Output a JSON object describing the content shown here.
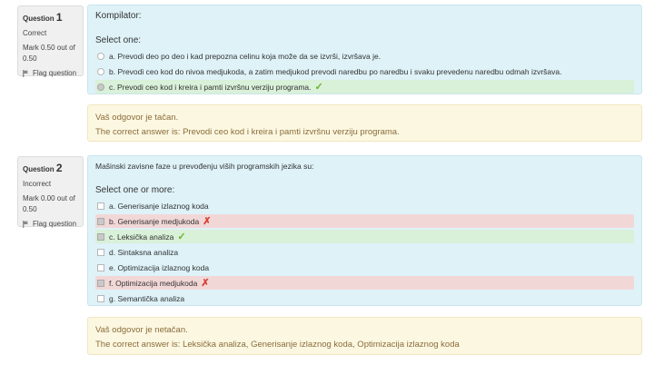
{
  "q1": {
    "label": "Question",
    "number": "1",
    "state": "Correct",
    "grade": "Mark 0.50 out of 0.50",
    "flag": "Flag question",
    "qtext": "Kompilator:",
    "prompt": "Select one:",
    "options": [
      {
        "text": "a. Prevodi deo po deo i kad prepozna celinu koja može da se izvrši, izvršava je."
      },
      {
        "text": "b. Prevodi ceo kod do nivoa medjukoda, a zatim medjukod prevodi naredbu po naredbu i svaku prevedenu naredbu odmah izvršava."
      },
      {
        "text": "c. Prevodi ceo kod i kreira i pamti izvršnu verziju programa."
      }
    ],
    "feedback": "Vaš odgovor je tačan.",
    "right_answer": "The correct answer is: Prevodi ceo kod i kreira i pamti izvršnu verziju programa."
  },
  "q2": {
    "label": "Question",
    "number": "2",
    "state": "Incorrect",
    "grade": "Mark 0.00 out of 0.50",
    "flag": "Flag question",
    "qtext": "Mašinski zavisne faze u prevođenju viših programskih jezika su:",
    "prompt": "Select one or more:",
    "options": [
      {
        "text": "a. Generisanje izlaznog koda"
      },
      {
        "text": "b. Generisanje medjukoda"
      },
      {
        "text": "c. Leksička analiza"
      },
      {
        "text": "d. Sintaksna analiza"
      },
      {
        "text": "e. Optimizacija izlaznog koda"
      },
      {
        "text": "f. Optimizacija medjukoda"
      },
      {
        "text": "g. Semantička analiza"
      }
    ],
    "feedback": "Vaš odgovor je netačan.",
    "right_answer": "The correct answer is: Leksička analiza, Generisanje izlaznog koda, Optimizacija izlaznog koda"
  },
  "icons": {
    "correct": "checkmark-icon",
    "incorrect": "cross-icon",
    "flag": "flag-icon"
  },
  "colors": {
    "correct_bg": "#d9f0d9",
    "incorrect_bg": "#f2d7d7",
    "formulation_bg": "#def2f8",
    "outcome_bg": "#fcf7e1"
  }
}
